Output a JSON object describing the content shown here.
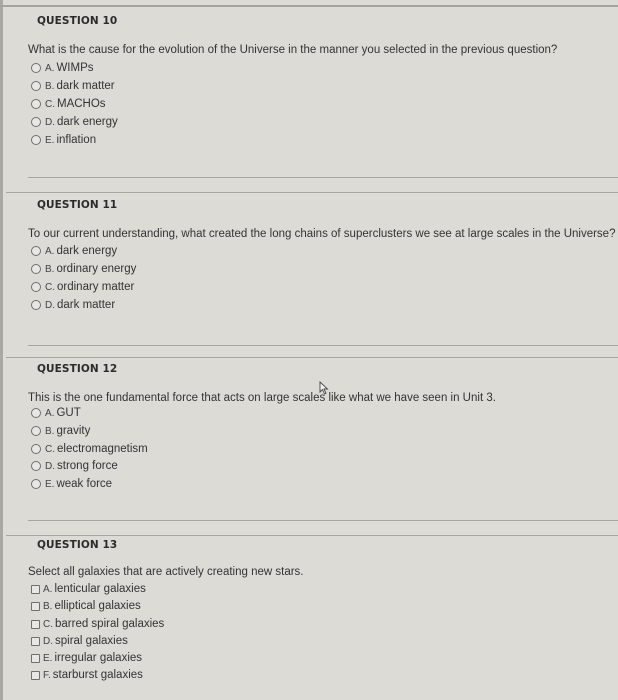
{
  "questions": [
    {
      "title": "QUESTION 10",
      "text": "What is the cause for the evolution of the Universe in the manner you selected in the previous question?",
      "input_type": "radio",
      "options": [
        {
          "letter": "A.",
          "label": "WIMPs"
        },
        {
          "letter": "B.",
          "label": "dark matter"
        },
        {
          "letter": "C.",
          "label": "MACHOs"
        },
        {
          "letter": "D.",
          "label": "dark energy"
        },
        {
          "letter": "E.",
          "label": "inflation"
        }
      ]
    },
    {
      "title": "QUESTION 11",
      "text": "To our current understanding, what created the long chains of superclusters we see at large scales in the Universe?",
      "input_type": "radio",
      "options": [
        {
          "letter": "A.",
          "label": "dark energy"
        },
        {
          "letter": "B.",
          "label": "ordinary energy"
        },
        {
          "letter": "C.",
          "label": "ordinary matter"
        },
        {
          "letter": "D.",
          "label": "dark matter"
        }
      ]
    },
    {
      "title": "QUESTION 12",
      "text": "This is the one fundamental force that acts on large scales like what we have seen in Unit 3.",
      "input_type": "radio",
      "options": [
        {
          "letter": "A.",
          "label": "GUT"
        },
        {
          "letter": "B.",
          "label": "gravity"
        },
        {
          "letter": "C.",
          "label": "electromagnetism"
        },
        {
          "letter": "D.",
          "label": "strong force"
        },
        {
          "letter": "E.",
          "label": "weak force"
        }
      ]
    },
    {
      "title": "QUESTION 13",
      "text": "Select all galaxies that are actively creating new stars.",
      "input_type": "checkbox",
      "options": [
        {
          "letter": "A.",
          "label": "lenticular galaxies"
        },
        {
          "letter": "B.",
          "label": "elliptical galaxies"
        },
        {
          "letter": "C.",
          "label": "barred spiral galaxies"
        },
        {
          "letter": "D.",
          "label": "spiral galaxies"
        },
        {
          "letter": "E.",
          "label": "irregular galaxies"
        },
        {
          "letter": "F.",
          "label": "starburst galaxies"
        }
      ]
    }
  ]
}
